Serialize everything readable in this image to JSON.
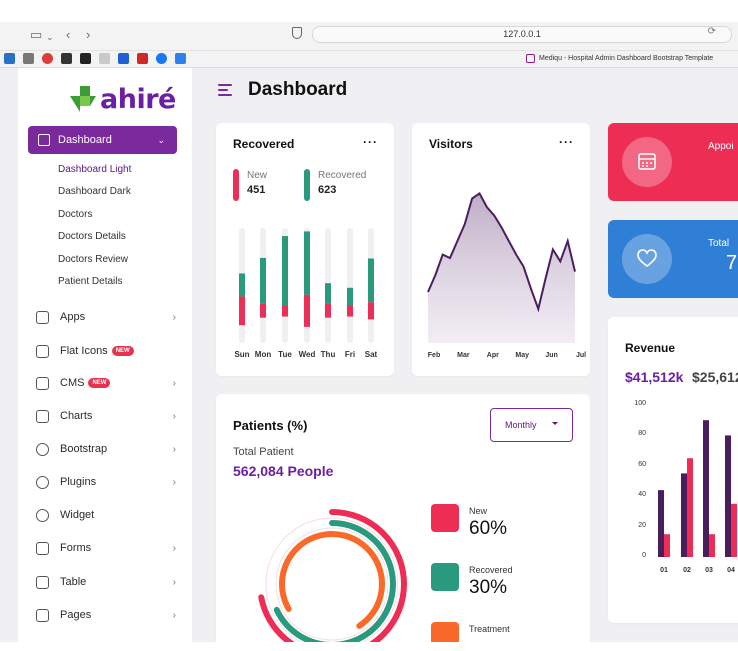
{
  "browser": {
    "url": "127.0.0.1",
    "tab_title": "Mediqu - Hospital Admin Dashboard Bootstrap Template"
  },
  "logo": {
    "text": "ahiré"
  },
  "sidebar": {
    "active": {
      "label": "Dashboard",
      "icon": "dashboard-icon"
    },
    "subitems": [
      {
        "label": "Dashboard Light",
        "active": true
      },
      {
        "label": "Dashboard Dark",
        "active": false
      },
      {
        "label": "Doctors",
        "active": false
      },
      {
        "label": "Doctors Details",
        "active": false
      },
      {
        "label": "Doctors Review",
        "active": false
      },
      {
        "label": "Patient Details",
        "active": false
      }
    ],
    "items": [
      {
        "label": "Apps",
        "icon": "monitor-icon",
        "badge": "",
        "chevron": true
      },
      {
        "label": "Flat Icons",
        "icon": "document-icon",
        "badge": "NEW",
        "chevron": false
      },
      {
        "label": "CMS",
        "icon": "cms-icon",
        "badge": "NEW",
        "chevron": true
      },
      {
        "label": "Charts",
        "icon": "sliders-icon",
        "badge": "",
        "chevron": true
      },
      {
        "label": "Bootstrap",
        "icon": "globe-icon",
        "badge": "",
        "chevron": true
      },
      {
        "label": "Plugins",
        "icon": "heart-icon",
        "badge": "",
        "chevron": true
      },
      {
        "label": "Widget",
        "icon": "gear-icon",
        "badge": "",
        "chevron": false
      },
      {
        "label": "Forms",
        "icon": "forms-icon",
        "badge": "",
        "chevron": true
      },
      {
        "label": "Table",
        "icon": "table-icon",
        "badge": "",
        "chevron": true
      },
      {
        "label": "Pages",
        "icon": "layers-icon",
        "badge": "",
        "chevron": true
      }
    ]
  },
  "header": {
    "title": "Dashboard"
  },
  "recovered_card": {
    "title": "Recovered",
    "menu": "···",
    "legend": [
      {
        "label": "New",
        "value": "451",
        "color": "#ec2f58"
      },
      {
        "label": "Recovered",
        "value": "623",
        "color": "#2a9a7e"
      }
    ]
  },
  "visitors_card": {
    "title": "Visitors",
    "menu": "···"
  },
  "stats": [
    {
      "label": "Appoi",
      "value": "",
      "color": "#ee2d55"
    },
    {
      "label": "Total",
      "value": "7",
      "color": "#2f7fd6"
    }
  ],
  "revenue_card": {
    "title": "Revenue",
    "primary": "$41,512k",
    "secondary": "$25,612"
  },
  "patients_card": {
    "title": "Patients (%)",
    "filter": "Monthly",
    "subtitle": "Total Patient",
    "total": "562,084 People",
    "legend": [
      {
        "label": "New",
        "value": "60%",
        "color": "#ee2d55"
      },
      {
        "label": "Recovered",
        "value": "30%",
        "color": "#2a9a7e"
      },
      {
        "label": "Treatment",
        "value": "",
        "color": "#f96a2a"
      }
    ]
  },
  "chart_data": [
    {
      "type": "bar",
      "title": "Recovered",
      "categories": [
        "Sun",
        "Mon",
        "Tue",
        "Wed",
        "Thu",
        "Fri",
        "Sat"
      ],
      "series": [
        {
          "name": "Recovered",
          "color": "#2a9a7e",
          "values": [
            20,
            40,
            60,
            55,
            18,
            15,
            38
          ]
        },
        {
          "name": "New",
          "color": "#ec2f58",
          "values": [
            25,
            12,
            10,
            28,
            12,
            10,
            15
          ]
        }
      ],
      "ylim": [
        0,
        100
      ]
    },
    {
      "type": "area",
      "title": "Visitors",
      "categories": [
        "Feb",
        "Mar",
        "Apr",
        "May",
        "Jun",
        "Jul"
      ],
      "x": [
        0,
        0.25,
        0.5,
        0.75,
        1,
        1.25,
        1.5,
        1.75,
        2,
        2.25,
        2.5,
        2.75,
        3,
        3.25,
        3.5,
        3.75,
        4,
        4.25,
        4.5,
        4.75,
        5
      ],
      "values": [
        30,
        40,
        52,
        50,
        60,
        70,
        85,
        88,
        80,
        75,
        68,
        60,
        52,
        45,
        32,
        20,
        38,
        55,
        48,
        60,
        42
      ],
      "ylim": [
        0,
        100
      ]
    },
    {
      "type": "bar",
      "title": "Revenue",
      "categories": [
        "01",
        "02",
        "03",
        "04"
      ],
      "series": [
        {
          "name": "",
          "color": "#4a1e5c",
          "values": [
            44,
            55,
            90,
            80
          ]
        },
        {
          "name": "",
          "color": "#ee2d55",
          "values": [
            15,
            65,
            15,
            35
          ]
        }
      ],
      "ylim": [
        0,
        100
      ],
      "yticks": [
        "100",
        "80",
        "60",
        "40",
        "20",
        "0"
      ]
    },
    {
      "type": "pie",
      "title": "Patients (%)",
      "categories": [
        "New",
        "Recovered",
        "Treatment"
      ],
      "values": [
        60,
        30,
        10
      ]
    }
  ]
}
